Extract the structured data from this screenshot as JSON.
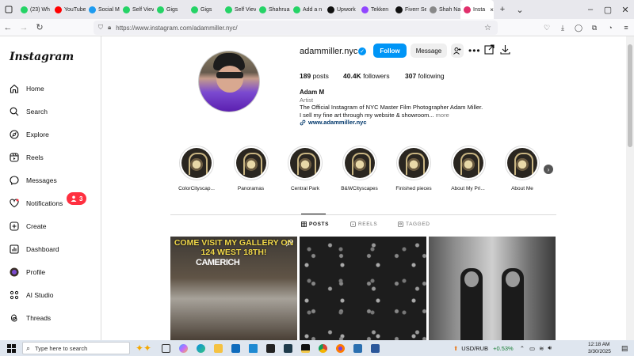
{
  "browser": {
    "tabs": [
      {
        "label": "(23) Wh",
        "color": "#25d366"
      },
      {
        "label": "YouTube",
        "color": "#ff0000"
      },
      {
        "label": "Social M",
        "color": "#1d9bf0"
      },
      {
        "label": "Self Viev",
        "color": "#25d366"
      },
      {
        "label": "Gigs",
        "color": "#25d366"
      },
      {
        "label": "Gigs",
        "color": "#25d366"
      },
      {
        "label": "Self Viev",
        "color": "#25d366"
      },
      {
        "label": "Shahrua",
        "color": "#25d366"
      },
      {
        "label": "Add a n",
        "color": "#25d366"
      },
      {
        "label": "Upwork",
        "color": "#111111"
      },
      {
        "label": "Tekken",
        "color": "#9146ff"
      },
      {
        "label": "Fiverr Se",
        "color": "#111111"
      },
      {
        "label": "Shah Na",
        "color": "#888888"
      },
      {
        "label": "Insta",
        "color": "#e1306c",
        "active": true
      }
    ],
    "url": "https://www.instagram.com/adammiller.nyc/"
  },
  "sidebar": {
    "logo": "Instagram",
    "items": [
      {
        "label": "Home",
        "icon": "home-icon"
      },
      {
        "label": "Search",
        "icon": "search-icon"
      },
      {
        "label": "Explore",
        "icon": "compass-icon"
      },
      {
        "label": "Reels",
        "icon": "reels-icon"
      },
      {
        "label": "Messages",
        "icon": "messenger-icon"
      },
      {
        "label": "Notifications",
        "icon": "heart-icon"
      },
      {
        "label": "Create",
        "icon": "plus-square-icon"
      },
      {
        "label": "Dashboard",
        "icon": "dashboard-icon"
      },
      {
        "label": "Profile",
        "icon": "avatar"
      },
      {
        "label": "AI Studio",
        "icon": "ai-studio-icon"
      },
      {
        "label": "Threads",
        "icon": "threads-icon"
      }
    ],
    "notification_badge": "3"
  },
  "profile": {
    "username": "adammiller.nyc",
    "follow": "Follow",
    "message": "Message",
    "posts_count": "189",
    "posts_label": "posts",
    "followers_count": "40.4K",
    "followers_label": "followers",
    "following_count": "307",
    "following_label": "following",
    "full_name": "Adam M",
    "category": "Artist",
    "bio_line1": "The Official Instagram of NYC Master Film Photographer Adam Miller.",
    "bio_line2": "I sell my fine art through my website & showroom...",
    "bio_more": "more",
    "link": "www.adammiller.nyc"
  },
  "highlights": [
    "ColorCityscap...",
    "Panoramas",
    "Central Park",
    "B&WCityscapes",
    "Finished pieces",
    "About My Pri...",
    "About Me"
  ],
  "tabs": {
    "posts": "POSTS",
    "reels": "REELS",
    "tagged": "TAGGED"
  },
  "posts": {
    "post1_text": "COME VISIT MY GALLERY ON 124 WEST 18TH!",
    "post1_sign": "CAMERICH"
  },
  "taskbar": {
    "search_placeholder": "Type here to search",
    "currency": "USD/RUB",
    "change": "+0.53%",
    "time": "12:18 AM",
    "date": "3/30/2025"
  }
}
